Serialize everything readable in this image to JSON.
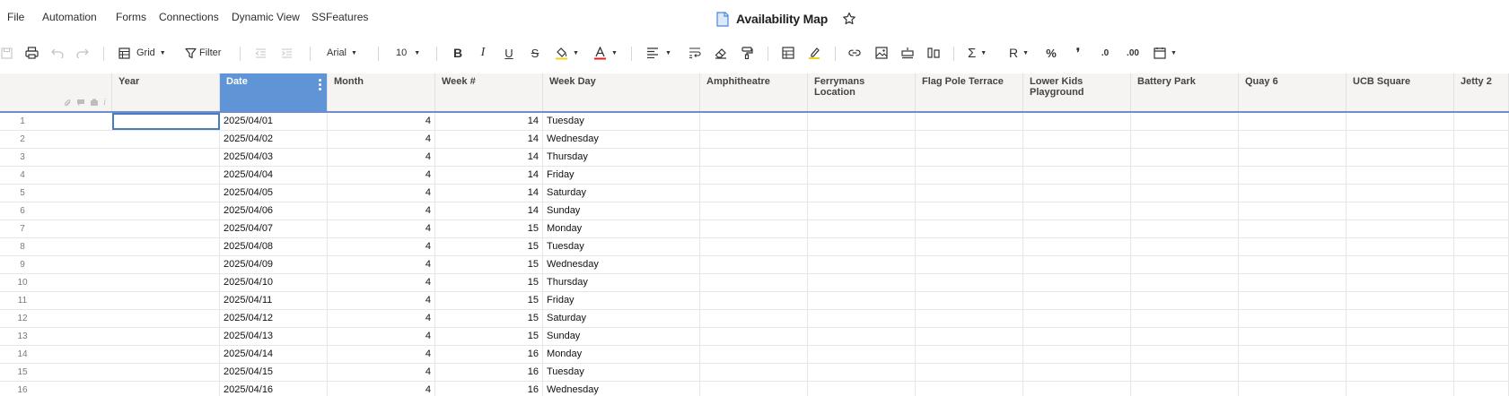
{
  "menu": [
    "File",
    "Automation",
    "Forms",
    "Connections",
    "Dynamic View",
    "SSFeatures"
  ],
  "title": "Availability Map",
  "toolbar": {
    "grid_label": "Grid",
    "filter_label": "Filter",
    "font_name": "Arial",
    "font_size": "10",
    "bold": "B",
    "italic": "I",
    "underline": "U",
    "strike": "S",
    "sum": "Σ",
    "currency": "R",
    "percent": "%",
    "comma": "❜",
    "dec_less": ".0",
    "dec_more": ".00",
    "date_label": "31"
  },
  "columns": [
    "Year",
    "Date",
    "Month",
    "Week #",
    "Week Day",
    "Amphitheatre",
    "Ferrymans Location",
    "Flag Pole Terrace",
    "Lower Kids Playground",
    "Battery Park",
    "Quay 6",
    "UCB Square",
    "Jetty 2"
  ],
  "selected_column": "Date",
  "rows": [
    {
      "n": "1",
      "date": "2025/04/01",
      "month": "4",
      "week": "14",
      "day": "Tuesday"
    },
    {
      "n": "2",
      "date": "2025/04/02",
      "month": "4",
      "week": "14",
      "day": "Wednesday"
    },
    {
      "n": "3",
      "date": "2025/04/03",
      "month": "4",
      "week": "14",
      "day": "Thursday"
    },
    {
      "n": "4",
      "date": "2025/04/04",
      "month": "4",
      "week": "14",
      "day": "Friday"
    },
    {
      "n": "5",
      "date": "2025/04/05",
      "month": "4",
      "week": "14",
      "day": "Saturday"
    },
    {
      "n": "6",
      "date": "2025/04/06",
      "month": "4",
      "week": "14",
      "day": "Sunday"
    },
    {
      "n": "7",
      "date": "2025/04/07",
      "month": "4",
      "week": "15",
      "day": "Monday"
    },
    {
      "n": "8",
      "date": "2025/04/08",
      "month": "4",
      "week": "15",
      "day": "Tuesday"
    },
    {
      "n": "9",
      "date": "2025/04/09",
      "month": "4",
      "week": "15",
      "day": "Wednesday"
    },
    {
      "n": "10",
      "date": "2025/04/10",
      "month": "4",
      "week": "15",
      "day": "Thursday"
    },
    {
      "n": "11",
      "date": "2025/04/11",
      "month": "4",
      "week": "15",
      "day": "Friday"
    },
    {
      "n": "12",
      "date": "2025/04/12",
      "month": "4",
      "week": "15",
      "day": "Saturday"
    },
    {
      "n": "13",
      "date": "2025/04/13",
      "month": "4",
      "week": "15",
      "day": "Sunday"
    },
    {
      "n": "14",
      "date": "2025/04/14",
      "month": "4",
      "week": "16",
      "day": "Monday"
    },
    {
      "n": "15",
      "date": "2025/04/15",
      "month": "4",
      "week": "16",
      "day": "Tuesday"
    },
    {
      "n": "16",
      "date": "2025/04/16",
      "month": "4",
      "week": "16",
      "day": "Wednesday"
    }
  ]
}
